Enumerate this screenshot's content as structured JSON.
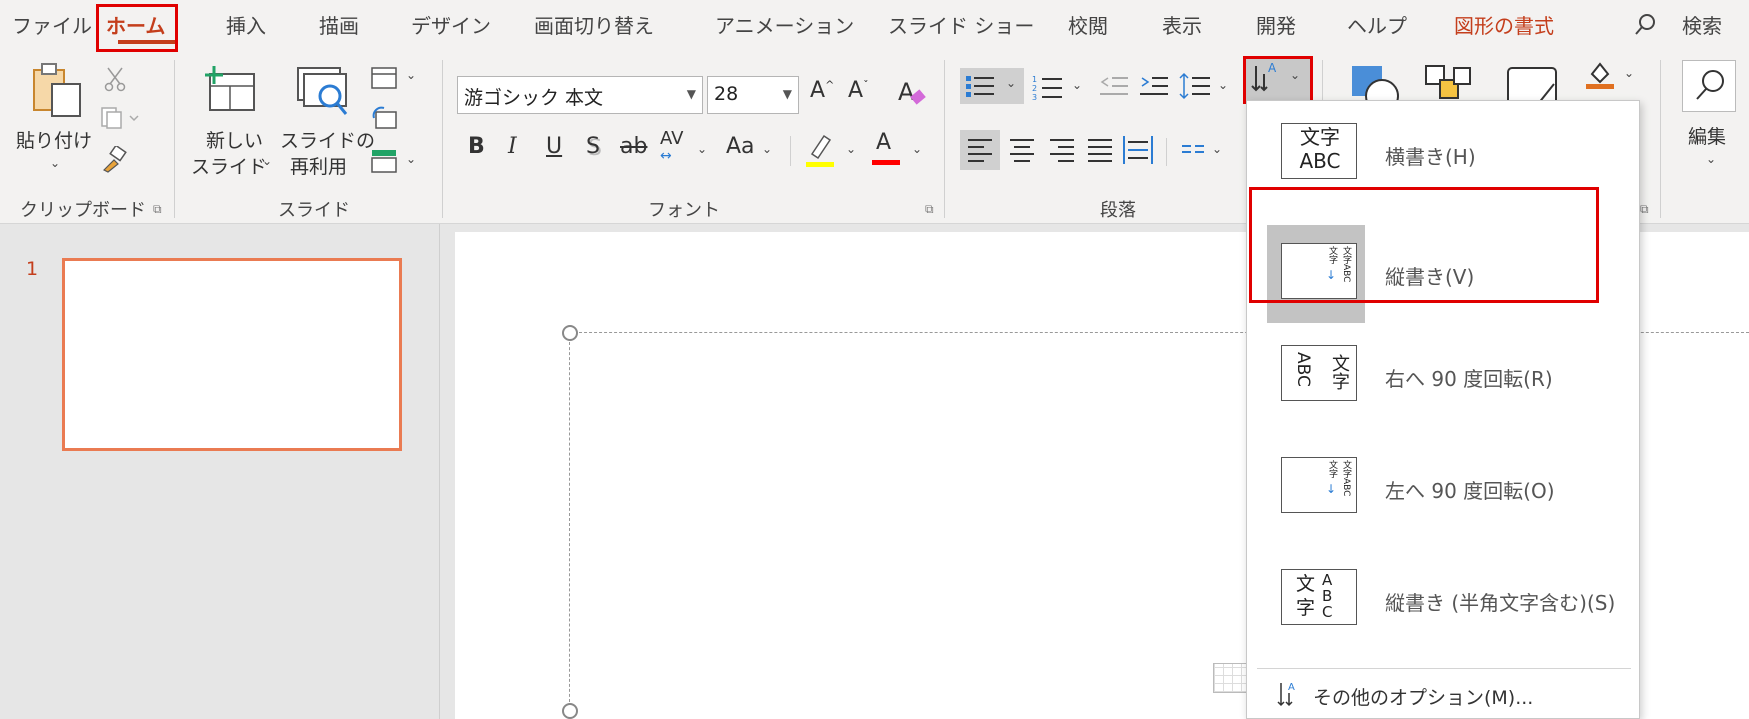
{
  "tabs": {
    "file": "ファイル",
    "home": "ホーム",
    "insert": "挿入",
    "draw": "描画",
    "design": "デザイン",
    "transitions": "画面切り替え",
    "animations": "アニメーション",
    "slideshow": "スライド ショー",
    "review": "校閲",
    "view": "表示",
    "developer": "開発",
    "help": "ヘルプ",
    "shape_format": "図形の書式",
    "search": "検索"
  },
  "ribbon": {
    "clipboard": {
      "label": "クリップボード",
      "paste": "貼り付け"
    },
    "slides": {
      "label": "スライド",
      "new_slide_1": "新しい",
      "new_slide_2": "スライド",
      "reuse_1": "スライドの",
      "reuse_2": "再利用"
    },
    "font": {
      "label": "フォント",
      "font_name": "游ゴシック 本文",
      "font_size": "28"
    },
    "paragraph": {
      "label": "段落"
    },
    "editing": {
      "label": "編集"
    }
  },
  "colors": {
    "accent": "#c43e1c",
    "highlight": "#ffff00",
    "font_color": "#ff0000",
    "selection": "#e00000"
  },
  "slides_pane": {
    "number": "1"
  },
  "text_direction_menu": {
    "items": [
      {
        "icon": "horizontal-text-icon",
        "label": "横書き(H)",
        "selected": false
      },
      {
        "icon": "vertical-text-icon",
        "label": "縦書き(V)",
        "selected": true
      },
      {
        "icon": "rotate-right-icon",
        "label": "右へ 90 度回転(R)",
        "selected": false
      },
      {
        "icon": "rotate-left-icon",
        "label": "左へ 90 度回転(O)",
        "selected": false
      },
      {
        "icon": "stacked-text-icon",
        "label": "縦書き (半角文字含む)(S)",
        "selected": false
      }
    ],
    "more": "その他のオプション(M)..."
  },
  "icon_text": {
    "moji": "文字",
    "abc": "ABC",
    "font_a": "A",
    "bold": "B",
    "italic": "I",
    "underline": "U",
    "shadow": "S",
    "strike": "ab",
    "spacing": "AV",
    "case": "Aa"
  }
}
